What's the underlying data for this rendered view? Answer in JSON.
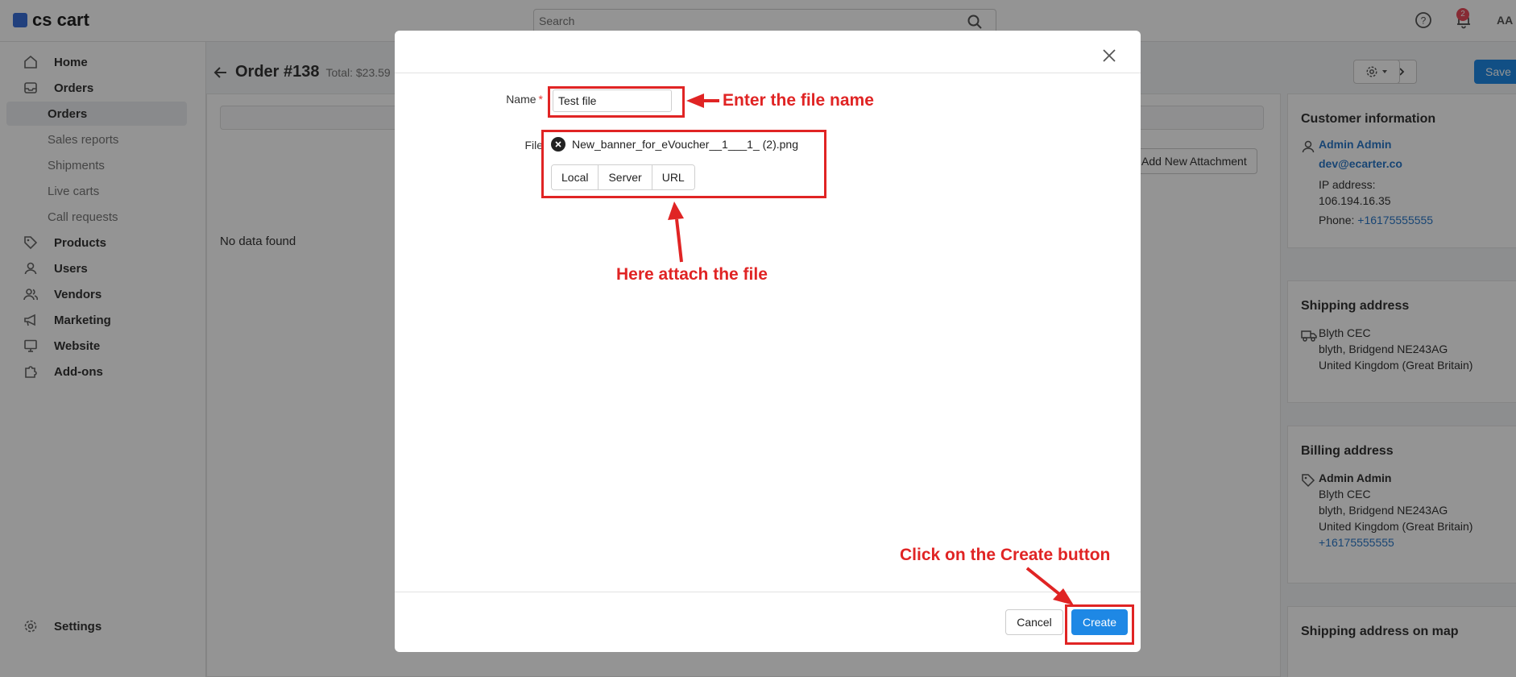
{
  "app": {
    "logo_text": "cs cart",
    "brand_color": "#3a6fd8"
  },
  "header": {
    "search_placeholder": "Search",
    "notifications_count": "2",
    "avatar_initials": "AA"
  },
  "sidebar": {
    "items": [
      {
        "label": "Home",
        "icon": "home-icon"
      },
      {
        "label": "Orders",
        "icon": "inbox-icon"
      },
      {
        "label": "Orders",
        "sub": true,
        "active": true
      },
      {
        "label": "Sales reports",
        "sub": true
      },
      {
        "label": "Shipments",
        "sub": true
      },
      {
        "label": "Live carts",
        "sub": true
      },
      {
        "label": "Call requests",
        "sub": true
      },
      {
        "label": "Products",
        "icon": "tag-icon"
      },
      {
        "label": "Users",
        "icon": "user-icon"
      },
      {
        "label": "Vendors",
        "icon": "users-icon"
      },
      {
        "label": "Marketing",
        "icon": "megaphone-icon"
      },
      {
        "label": "Website",
        "icon": "monitor-icon"
      },
      {
        "label": "Add-ons",
        "icon": "puzzle-icon"
      }
    ],
    "settings_label": "Settings"
  },
  "order": {
    "title": "Order #138",
    "total": "Total: $23.59",
    "add_attachment_label": "Add New Attachment",
    "no_data": "No data found",
    "save_label": "Save"
  },
  "customer": {
    "title": "Customer information",
    "name": "Admin Admin",
    "email": "dev@ecarter.co",
    "ip_label": "IP address:",
    "ip": "106.194.16.35",
    "phone_label": "Phone:",
    "phone": "+16175555555"
  },
  "shipping": {
    "title": "Shipping address",
    "lines": [
      "Blyth CEC",
      "blyth, Bridgend NE243AG",
      "United Kingdom (Great Britain)"
    ]
  },
  "billing": {
    "title": "Billing address",
    "name": "Admin Admin",
    "lines": [
      "Blyth CEC",
      "blyth, Bridgend NE243AG",
      "United Kingdom (Great Britain)"
    ],
    "phone": "+16175555555"
  },
  "map_card": {
    "title": "Shipping address on map"
  },
  "modal": {
    "name_label": "Name",
    "required_mark": "*",
    "name_value": "Test file",
    "file_label": "File",
    "file_name": "New_banner_for_eVoucher__1___1_ (2).png",
    "sources": [
      "Local",
      "Server",
      "URL"
    ],
    "cancel_label": "Cancel",
    "create_label": "Create"
  },
  "annotations": {
    "enter_name": "Enter the file name",
    "attach_file": "Here attach the file",
    "click_create": "Click on the Create button",
    "color": "#e02424"
  }
}
